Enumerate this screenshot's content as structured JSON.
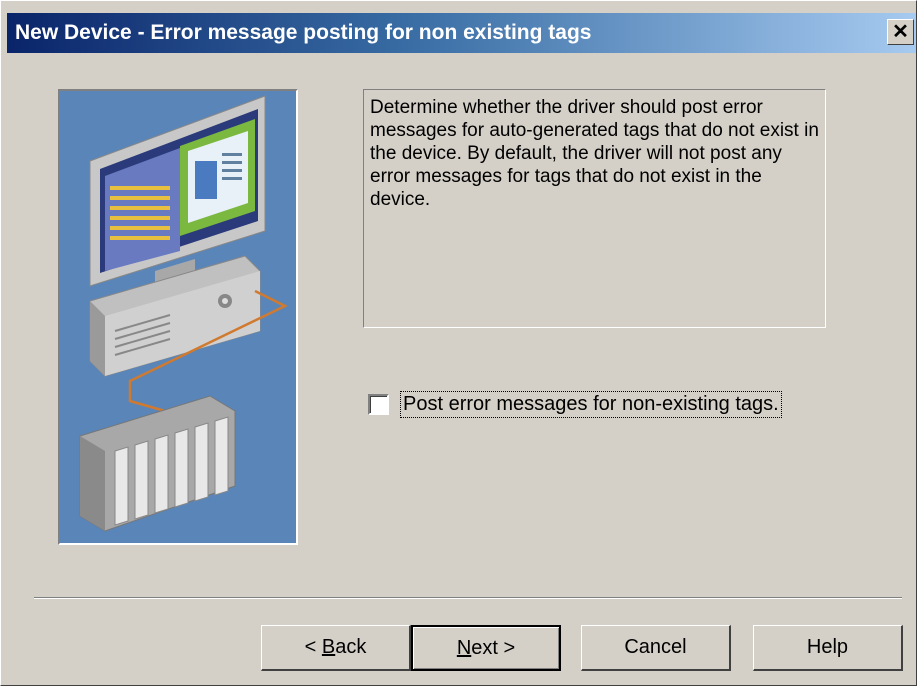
{
  "window": {
    "title": "New Device - Error message posting for non existing tags",
    "close_label": "✕"
  },
  "description": "Determine whether the driver should post error messages for auto-generated tags that do not exist in the device. By default, the driver will not post any error messages for tags that do not exist in the device.",
  "option": {
    "label": "Post error messages for non-existing tags.",
    "checked": false
  },
  "buttons": {
    "back_prefix": "< ",
    "back_accel": "B",
    "back_rest": "ack",
    "next_accel": "N",
    "next_rest": "ext >",
    "cancel": "Cancel",
    "help": "Help"
  },
  "colors": {
    "title_start": "#0a246a",
    "title_end": "#a6caf0",
    "illustration_bg": "#5a85b8",
    "dialog_bg": "#d4d0c8"
  }
}
